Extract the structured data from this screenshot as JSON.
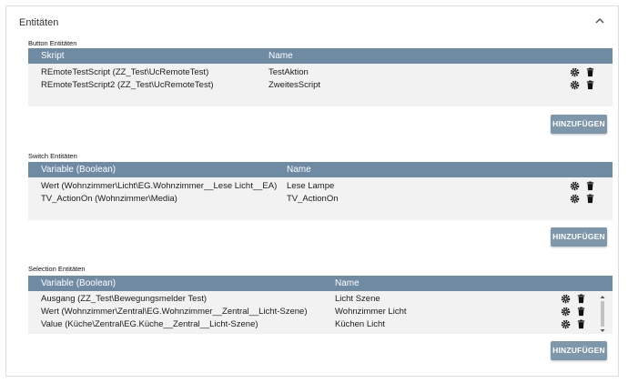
{
  "panel": {
    "title": "Entitäten"
  },
  "button_section": {
    "label": "Button Entitäten",
    "headers": [
      "Skript",
      "Name"
    ],
    "rows": [
      {
        "col1": "REmoteTestScript (ZZ_Test\\UcRemoteTest)",
        "col2": "TestAktion"
      },
      {
        "col1": "REmoteTestScript2 (ZZ_Test\\UcRemoteTest)",
        "col2": "ZweitesScript"
      }
    ],
    "add_label": "HINZUFÜGEN"
  },
  "switch_section": {
    "label": "Switch Entitäten",
    "headers": [
      "Variable (Boolean)",
      "Name"
    ],
    "rows": [
      {
        "col1": "Wert (Wohnzimmer\\Licht\\EG.Wohnzimmer__Lese Licht__EA)",
        "col2": "Lese Lampe"
      },
      {
        "col1": "TV_ActionOn (Wohnzimmer\\Media)",
        "col2": "TV_ActionOn"
      }
    ],
    "add_label": "HINZUFÜGEN"
  },
  "selection_section": {
    "label": "Selection Entitäten",
    "headers": [
      "Variable (Boolean)",
      "Name"
    ],
    "rows": [
      {
        "col1": "Ausgang (ZZ_Test\\Bewegungsmelder Test)",
        "col2": "Licht Szene"
      },
      {
        "col1": "Wert (Wohnzimmer\\Zentral\\EG.Wohnzimmer__Zentral__Licht-Szene)",
        "col2": "Wohnzimmer Licht"
      },
      {
        "col1": "Value (Küche\\Zentral\\EG.Küche__Zentral__Licht-Szene)",
        "col2": "Küchen Licht"
      }
    ],
    "add_label": "HINZUFÜGEN"
  },
  "icons": {
    "edit": "gear-icon",
    "delete": "trash-icon",
    "collapse": "chevron-up-icon"
  },
  "colors": {
    "header": "#6f8aa3",
    "button": "#7f97ab",
    "table_bg": "#f2f2f2"
  }
}
